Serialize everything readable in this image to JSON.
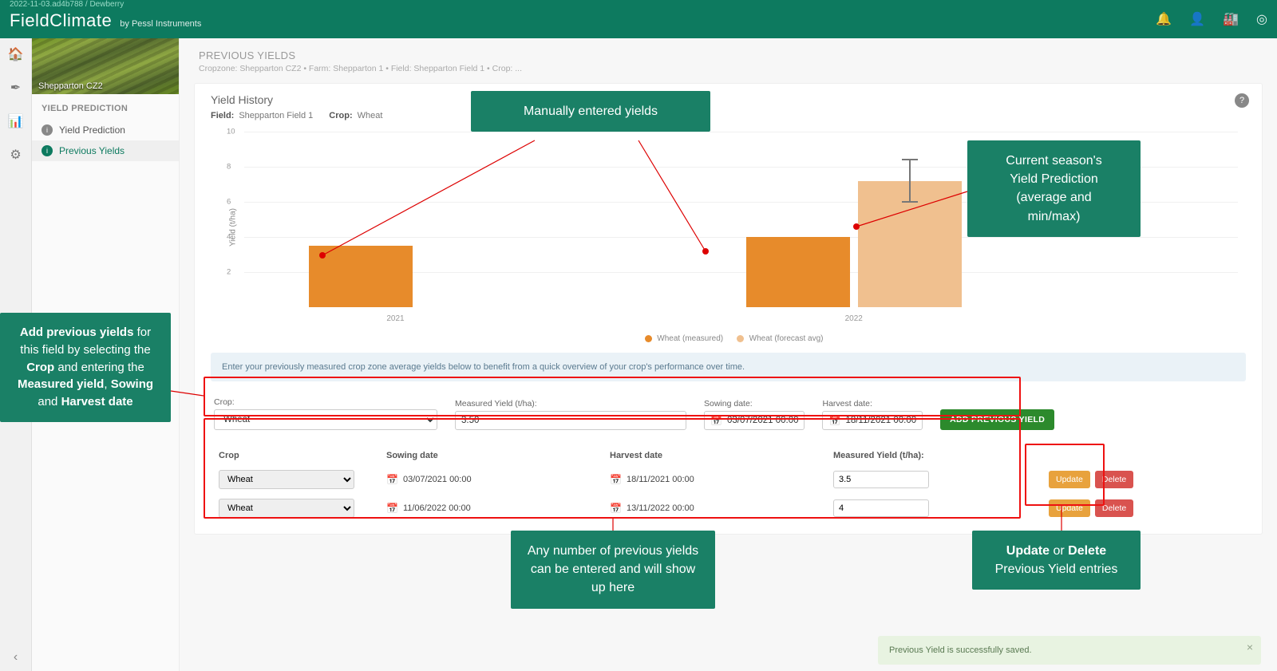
{
  "topbar": {
    "pre_text": "2022-11-03.ad4b788 / Dewberry",
    "brand_main": "FieldClimate",
    "brand_by": "by Pessl Instruments",
    "icons": [
      "bell-icon",
      "user-icon",
      "factory-icon",
      "broadcast-icon"
    ]
  },
  "sidebar": {
    "image_label": "Shepparton CZ2",
    "section_title": "YIELD PREDICTION",
    "items": [
      {
        "label": "Yield Prediction",
        "active": false
      },
      {
        "label": "Previous Yields",
        "active": true
      }
    ]
  },
  "breadcrumb": {
    "title": "PREVIOUS YIELDS",
    "path": "Cropzone: Shepparton CZ2 • Farm: Shepparton 1 • Field: Shepparton Field 1 • Crop: ..."
  },
  "history_card": {
    "title": "Yield History",
    "field_label": "Field:",
    "field_value": "Shepparton Field 1",
    "crop_label": "Crop:",
    "crop_value": "Wheat",
    "info_text": "Enter your previously measured crop zone average yields below to benefit from a quick overview of your crop's performance over time."
  },
  "chart_data": {
    "type": "bar",
    "ylabel": "Yield (t/ha)",
    "ylim": [
      0,
      10
    ],
    "yticks": [
      2,
      4,
      6,
      8,
      10
    ],
    "categories": [
      "2021",
      "2022"
    ],
    "series": [
      {
        "name": "Wheat (measured)",
        "color": "#e78b2b",
        "values": [
          3.5,
          4.0
        ]
      },
      {
        "name": "Wheat (forecast avg)",
        "color": "#f0c08f",
        "values": [
          null,
          7.2
        ],
        "error": [
          null,
          {
            "low": 6.0,
            "high": 8.4
          }
        ]
      }
    ]
  },
  "add_form": {
    "crop_label": "Crop:",
    "crop_value": "Wheat",
    "yield_label": "Measured Yield (t/ha):",
    "yield_value": "3.50",
    "sow_label": "Sowing date:",
    "sow_value": "03/07/2021 00:00",
    "harv_label": "Harvest date:",
    "harv_value": "18/11/2021 00:00",
    "button": "ADD PREVIOUS YIELD"
  },
  "table": {
    "headers": {
      "crop": "Crop",
      "sow": "Sowing date",
      "harv": "Harvest date",
      "yield": "Measured Yield (t/ha):"
    },
    "rows": [
      {
        "crop": "Wheat",
        "sow": "03/07/2021 00:00",
        "harv": "18/11/2021 00:00",
        "yield": "3.5"
      },
      {
        "crop": "Wheat",
        "sow": "11/06/2022 00:00",
        "harv": "13/11/2022 00:00",
        "yield": "4"
      }
    ],
    "update": "Update",
    "delete": "Delete"
  },
  "toast": {
    "msg": "Previous Yield is successfully saved."
  },
  "callouts": {
    "manual": "Manually entered yields",
    "forecast_l1": "Current season's",
    "forecast_l2": "Yield Prediction",
    "forecast_l3": "(average and",
    "forecast_l4": "min/max)",
    "addprev_l1a": "Add previous yields",
    "addprev_l1b": " for this field by selecting the ",
    "addprev_l1c": "Crop",
    "addprev_l2a": " and entering the ",
    "addprev_l2b": "Measured yield",
    "addprev_l3": ", ",
    "addprev_l4a": "Sowing",
    "addprev_l4b": " and ",
    "addprev_l4c": "Harvest date",
    "anynum_l1": "Any number of previous yields can be entered and will show up here",
    "upddel_l1a": "Update",
    "upddel_l1b": " or ",
    "upddel_l1c": "Delete",
    "upddel_l2": "Previous Yield entries"
  }
}
